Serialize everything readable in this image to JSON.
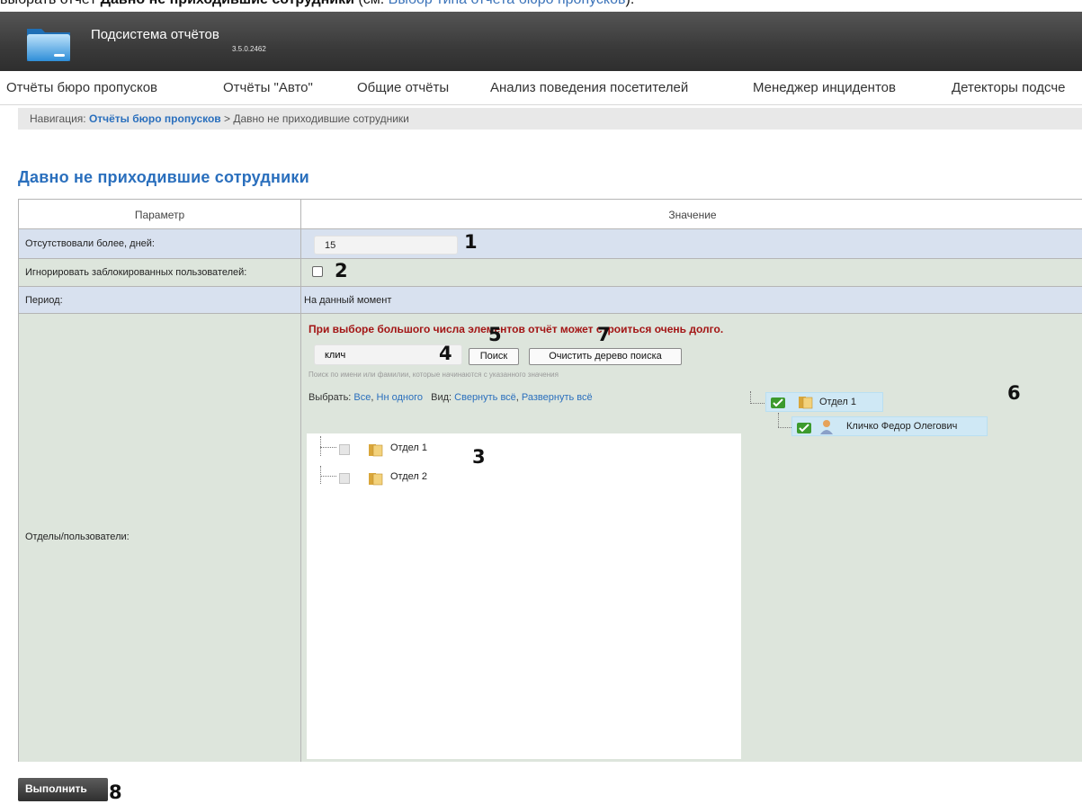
{
  "doc_caption": {
    "prefix": "выбрать отчёт ",
    "bold": "Давно не приходившие сотрудники",
    "mid": " (см. ",
    "link": "Выбор типа отчета бюро пропусков",
    "suffix": ")."
  },
  "app": {
    "title": "Подсистема отчётов",
    "version": "3.5.0.2462"
  },
  "menu": [
    "Отчёты бюро пропусков",
    "Отчёты \"Авто\"",
    "Общие отчёты",
    "Анализ поведения посетителей",
    "Менеджер инцидентов",
    "Детекторы подсче"
  ],
  "breadcrumb": {
    "prefix": "Навигация: ",
    "link": "Отчёты бюро пропусков",
    "sep": " > ",
    "current": "Давно не приходившие сотрудники"
  },
  "page_title": "Давно не приходившие сотрудники",
  "table": {
    "col_param": "Параметр",
    "col_value": "Значение",
    "absent_label": "Отсутствовали более, дней:",
    "absent_value": "15",
    "ignore_label": "Игнорировать заблокированных пользователей:",
    "period_label": "Период:",
    "period_value": "На данный момент",
    "depts_label": "Отделы/пользователи:"
  },
  "depts": {
    "warning": "При выборе большого числа элементов отчёт может строиться очень долго.",
    "search_value": "клич",
    "search_button": "Поиск",
    "clear_button": "Очистить дерево поиска",
    "hint": "Поиск по имени или фамилии, которые начинаются с указанного значения",
    "select_label": "Выбрать: ",
    "select_all": "Все",
    "comma": ", ",
    "select_none": "Нн одного",
    "view_label": "Вид: ",
    "collapse_all": "Свернуть всё",
    "expand_all": "Развернуть всё",
    "left_tree": [
      "Отдел 1",
      "Отдел 2"
    ],
    "right_tree": {
      "dept": "Отдел 1",
      "user": "Кличко Федор Олегович"
    }
  },
  "annotations": [
    "1",
    "2",
    "3",
    "4",
    "5",
    "6",
    "7",
    "8"
  ],
  "run_button": "Выполнить",
  "colors": {
    "link": "#2a6fbd",
    "warning": "#a31515",
    "row_blue": "#d8e1ef",
    "row_green": "#dde5dc",
    "selected_node": "#cfe8f5"
  }
}
